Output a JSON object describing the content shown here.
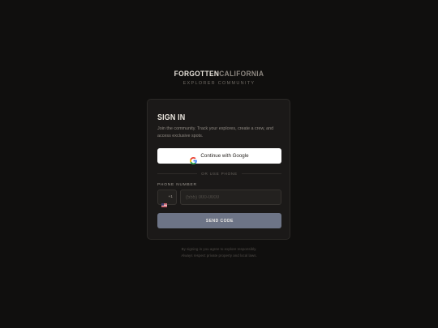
{
  "brand": {
    "name_part1": "FORGOTTEN",
    "name_part2": "CALIFORNIA",
    "tagline": "EXPLORER COMMUNITY"
  },
  "signin": {
    "title": "SIGN IN",
    "description": "Join the community. Track your explores, create a crew, and access exclusive spots.",
    "google_button_label": "Continue with Google",
    "google_icon": "google-g-icon",
    "divider_text": "OR USE PHONE",
    "phone_label": "PHONE NUMBER",
    "country_flag_icon": "us-flag-icon",
    "country_code": "+1",
    "phone_placeholder": "(555) 000-0000",
    "phone_value": "",
    "send_button_label": "SEND CODE"
  },
  "legal": {
    "line1": "By signing in you agree to explore responsibly.",
    "line2": "Always respect private property and local laws."
  },
  "colors": {
    "background": "#100f0e",
    "card": "#1b1918",
    "send_button": "#6d7486",
    "google_button": "#ffffff"
  }
}
